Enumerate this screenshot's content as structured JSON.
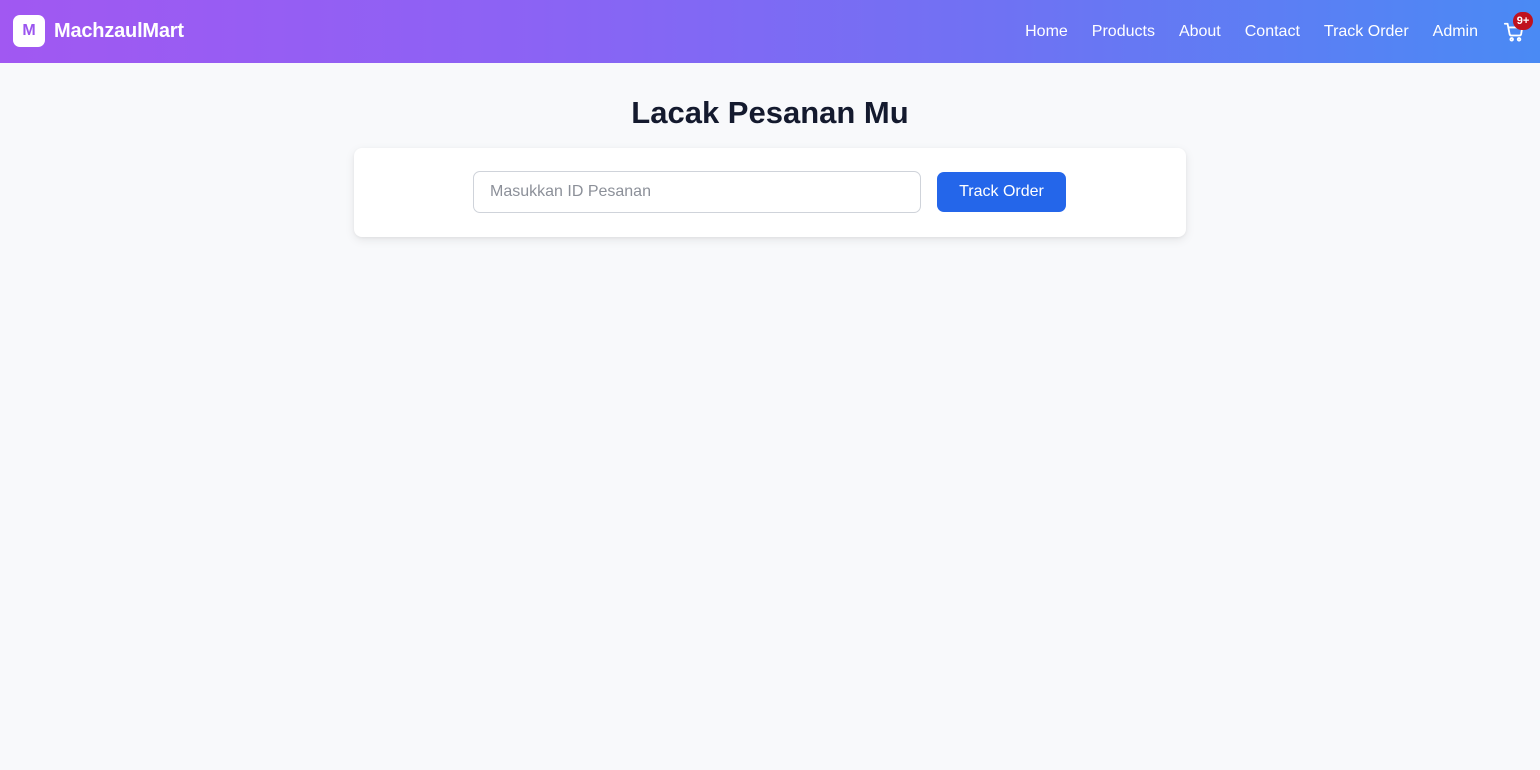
{
  "brand": {
    "logo_letter": "M",
    "name": "MachzaulMart"
  },
  "nav": {
    "items": [
      {
        "label": "Home"
      },
      {
        "label": "Products"
      },
      {
        "label": "About"
      },
      {
        "label": "Contact"
      },
      {
        "label": "Track Order"
      },
      {
        "label": "Admin"
      }
    ],
    "cart_icon": "shopping-cart-icon",
    "cart_badge": "9+"
  },
  "main": {
    "title": "Lacak Pesanan Mu",
    "search": {
      "placeholder": "Masukkan ID Pesanan",
      "value": ""
    },
    "track_button_label": "Track Order"
  },
  "colors": {
    "nav_gradient_start": "#a158f2",
    "nav_gradient_end": "#4a8af4",
    "button_primary": "#2466ea",
    "badge": "#c0121e",
    "page_background": "#f8f9fb"
  }
}
